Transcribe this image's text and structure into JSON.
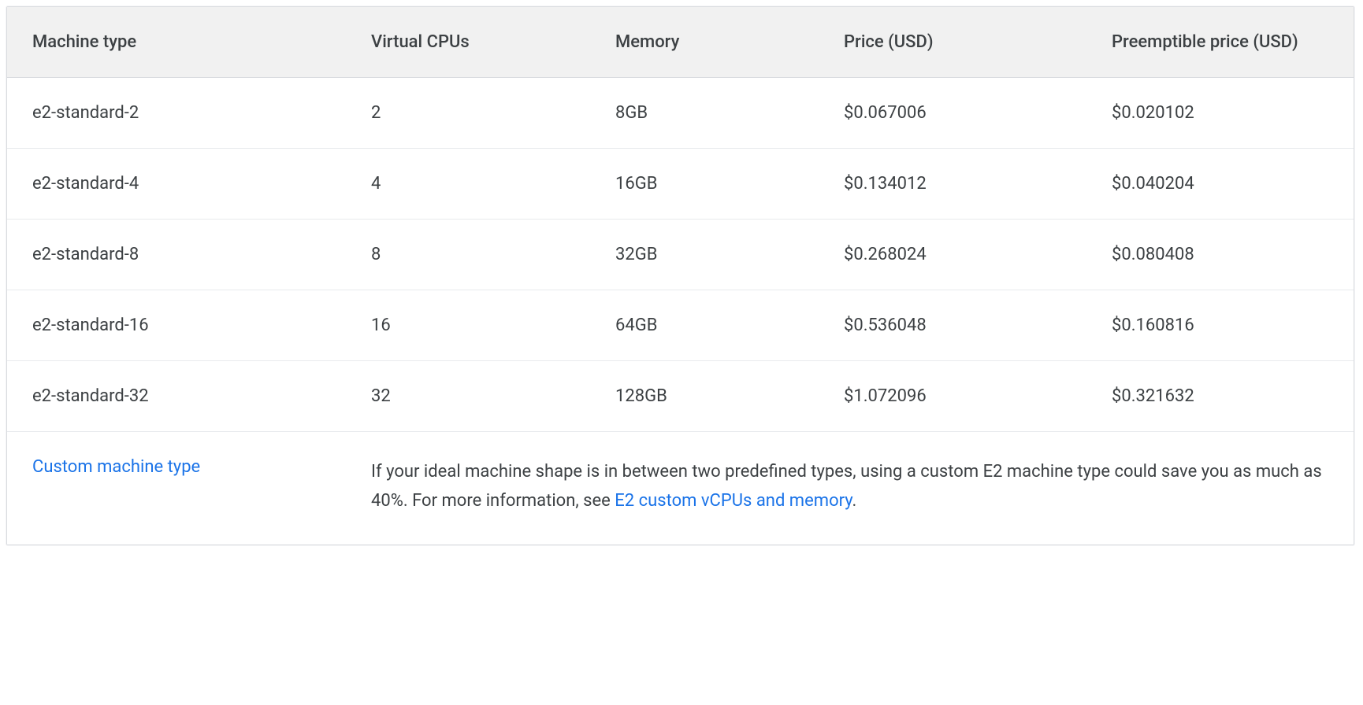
{
  "headers": {
    "machine_type": "Machine type",
    "virtual_cpus": "Virtual CPUs",
    "memory": "Memory",
    "price": "Price (USD)",
    "preemptible_price": "Preemptible price (USD)"
  },
  "rows": [
    {
      "machine_type": "e2-standard-2",
      "virtual_cpus": "2",
      "memory": "8GB",
      "price": "$0.067006",
      "preemptible_price": "$0.020102"
    },
    {
      "machine_type": "e2-standard-4",
      "virtual_cpus": "4",
      "memory": "16GB",
      "price": "$0.134012",
      "preemptible_price": "$0.040204"
    },
    {
      "machine_type": "e2-standard-8",
      "virtual_cpus": "8",
      "memory": "32GB",
      "price": "$0.268024",
      "preemptible_price": "$0.080408"
    },
    {
      "machine_type": "e2-standard-16",
      "virtual_cpus": "16",
      "memory": "64GB",
      "price": "$0.536048",
      "preemptible_price": "$0.160816"
    },
    {
      "machine_type": "e2-standard-32",
      "virtual_cpus": "32",
      "memory": "128GB",
      "price": "$1.072096",
      "preemptible_price": "$0.321632"
    }
  ],
  "footer": {
    "link_label": "Custom machine type",
    "desc_prefix": "If your ideal machine shape is in between two predefined types, using a custom E2 machine type could save you as much as 40%. For more information, see ",
    "desc_link": "E2 custom vCPUs and memory",
    "desc_suffix": "."
  }
}
